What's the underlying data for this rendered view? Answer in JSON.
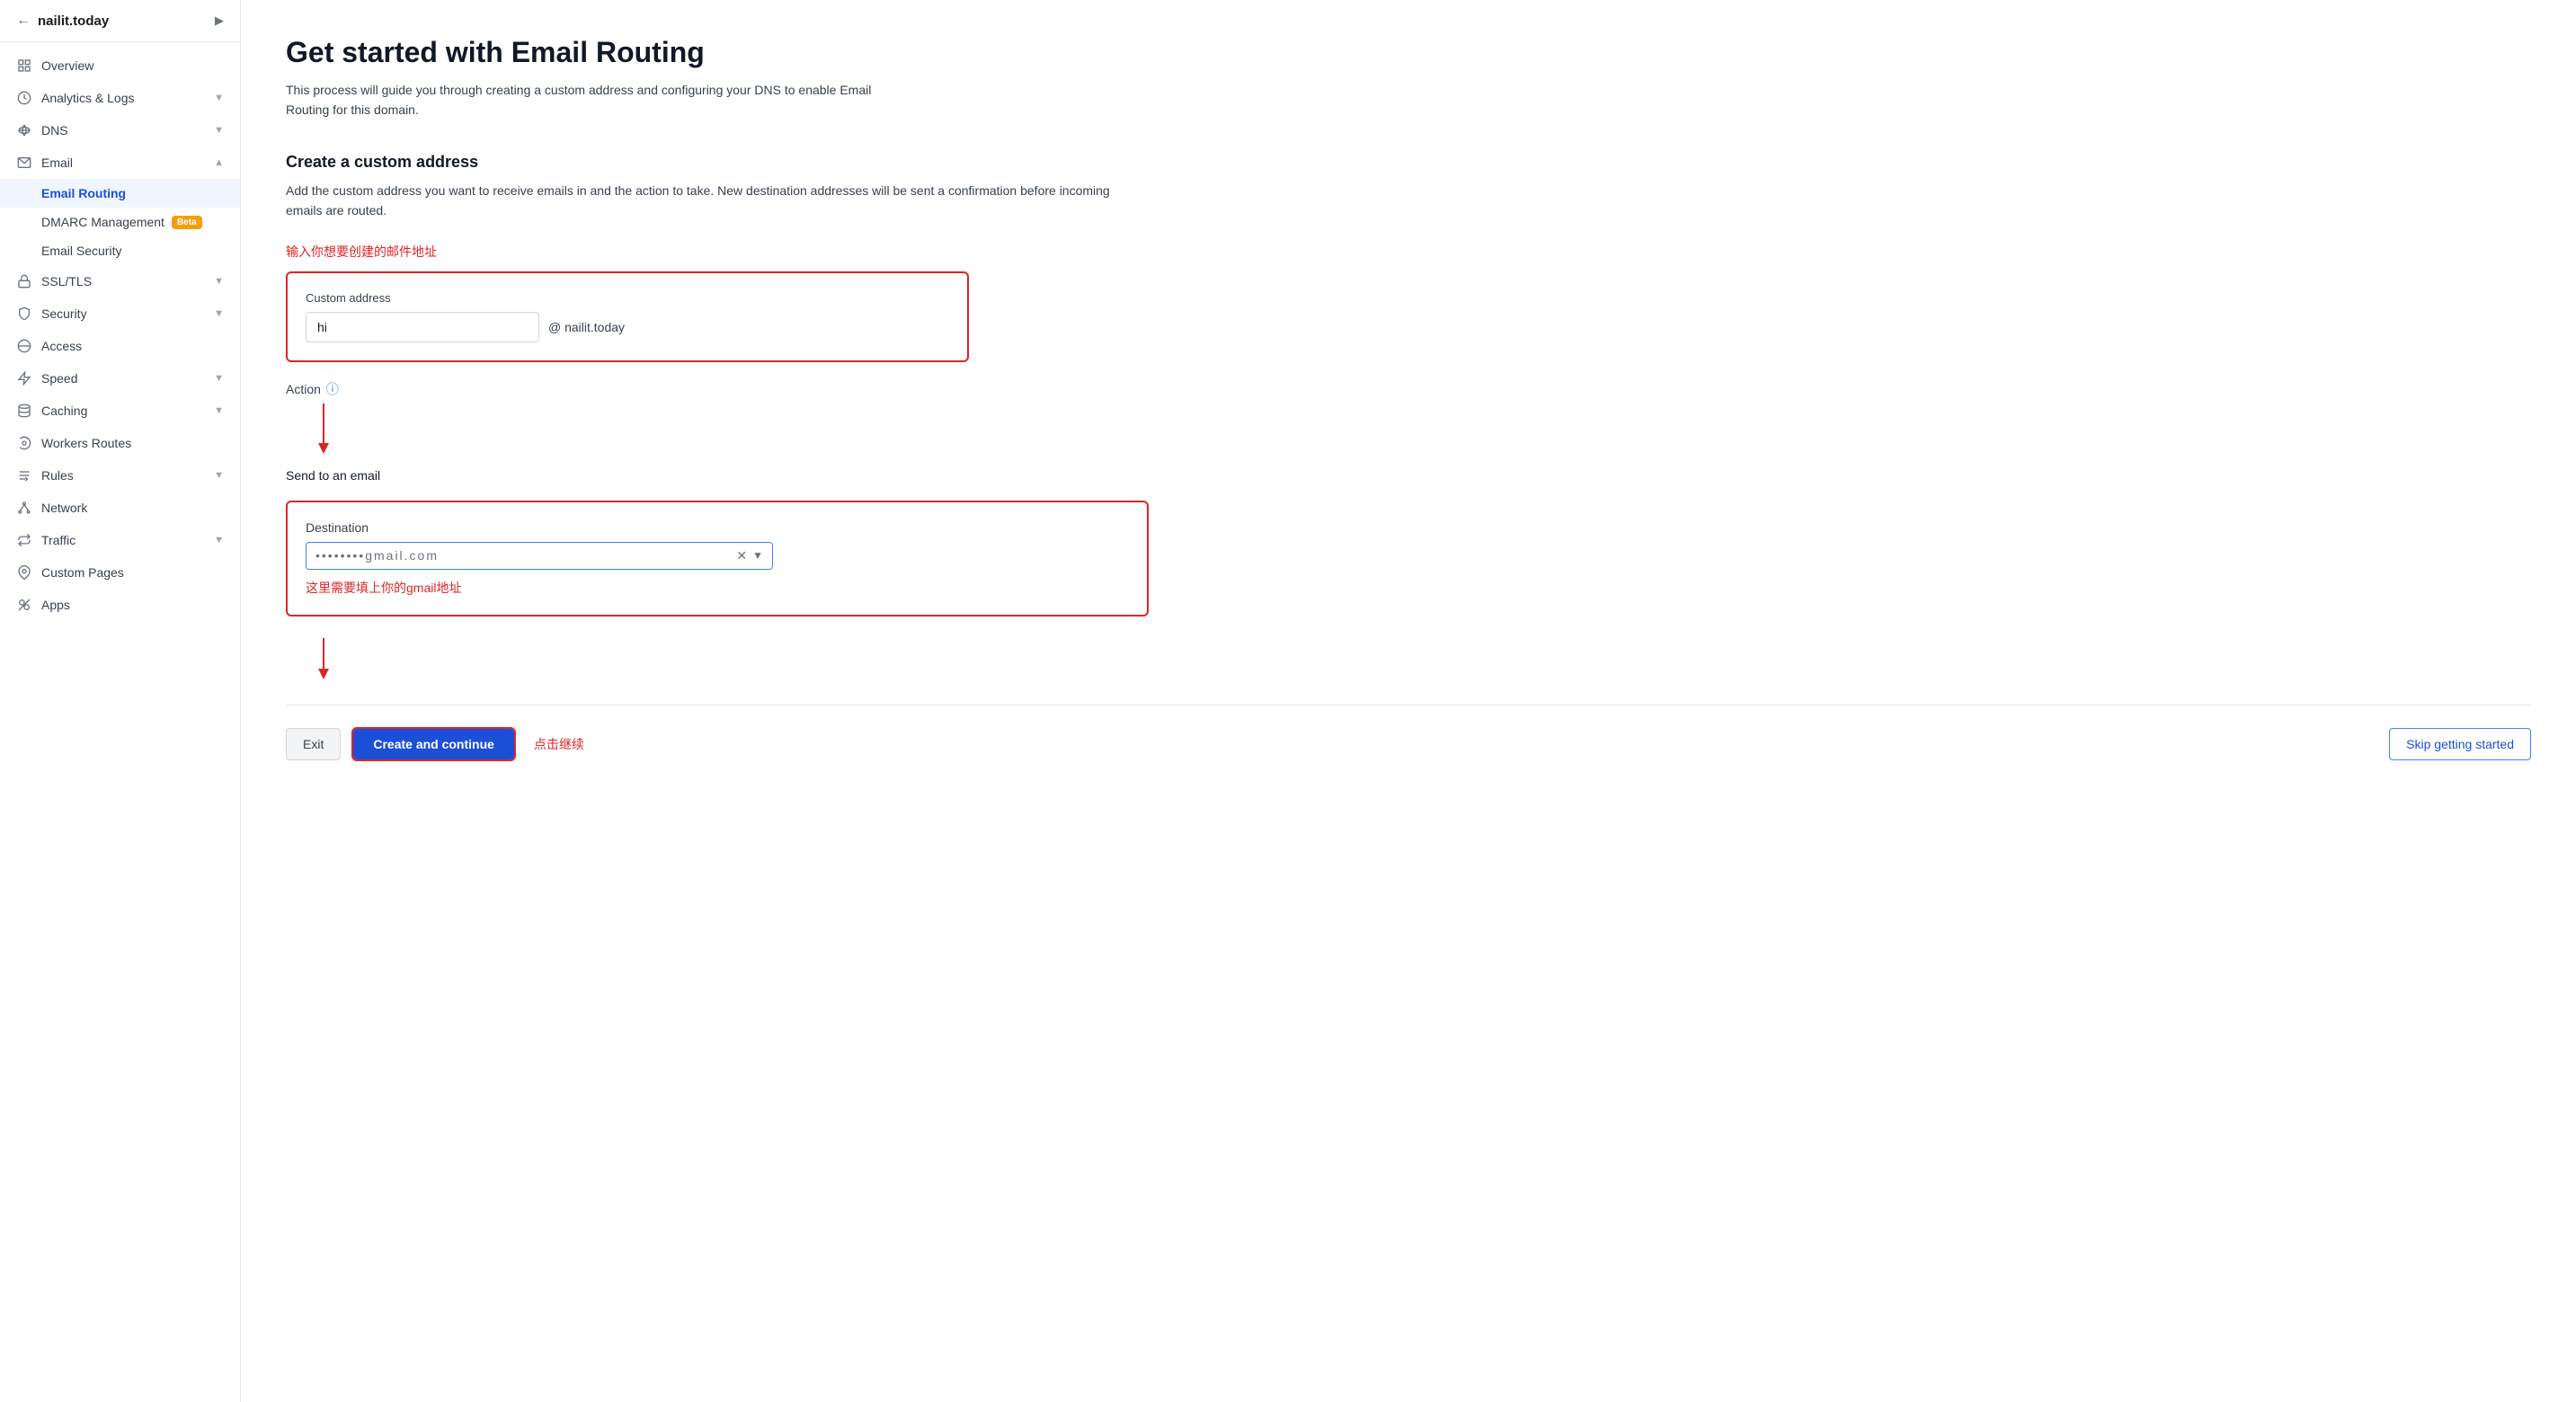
{
  "sidebar": {
    "domain": "nailit.today",
    "items": [
      {
        "id": "overview",
        "label": "Overview",
        "icon": "grid",
        "hasChevron": false
      },
      {
        "id": "analytics",
        "label": "Analytics & Logs",
        "icon": "chart",
        "hasChevron": true
      },
      {
        "id": "dns",
        "label": "DNS",
        "icon": "dns",
        "hasChevron": true
      },
      {
        "id": "email",
        "label": "Email",
        "icon": "email",
        "hasChevron": true,
        "expanded": true
      },
      {
        "id": "ssl",
        "label": "SSL/TLS",
        "icon": "lock",
        "hasChevron": true
      },
      {
        "id": "security",
        "label": "Security",
        "icon": "shield",
        "hasChevron": true
      },
      {
        "id": "access",
        "label": "Access",
        "icon": "access",
        "hasChevron": false
      },
      {
        "id": "speed",
        "label": "Speed",
        "icon": "speed",
        "hasChevron": true
      },
      {
        "id": "caching",
        "label": "Caching",
        "icon": "caching",
        "hasChevron": true
      },
      {
        "id": "workers",
        "label": "Workers Routes",
        "icon": "workers",
        "hasChevron": false
      },
      {
        "id": "rules",
        "label": "Rules",
        "icon": "rules",
        "hasChevron": true
      },
      {
        "id": "network",
        "label": "Network",
        "icon": "network",
        "hasChevron": false
      },
      {
        "id": "traffic",
        "label": "Traffic",
        "icon": "traffic",
        "hasChevron": true
      },
      {
        "id": "custompages",
        "label": "Custom Pages",
        "icon": "custompages",
        "hasChevron": false
      },
      {
        "id": "apps",
        "label": "Apps",
        "icon": "apps",
        "hasChevron": false
      }
    ],
    "emailSubItems": [
      {
        "id": "email-routing",
        "label": "Email Routing",
        "active": true
      },
      {
        "id": "dmarc",
        "label": "DMARC Management",
        "badge": "Beta"
      },
      {
        "id": "email-security",
        "label": "Email Security"
      }
    ]
  },
  "main": {
    "title": "Get started with Email Routing",
    "subtitle": "This process will guide you through creating a custom address and configuring your DNS to enable Email Routing for this domain.",
    "section1": {
      "title": "Create a custom address",
      "description": "Add the custom address you want to receive emails in and the action to take. New destination addresses will be sent a confirmation before incoming emails are routed.",
      "annotation1": "输入你想要创建的邮件地址",
      "custom_address_label": "Custom address",
      "address_value": "hi",
      "at_domain": "@ nailit.today",
      "action_label": "Action",
      "action_value": "Send to an email"
    },
    "section2": {
      "destination_label": "Destination",
      "destination_value": "••••••••gmail.com",
      "annotation2": "这里需要填上你的gmail地址"
    },
    "footer": {
      "exit_label": "Exit",
      "create_label": "Create and continue",
      "annotation_click": "点击继续",
      "skip_label": "Skip getting started"
    }
  }
}
